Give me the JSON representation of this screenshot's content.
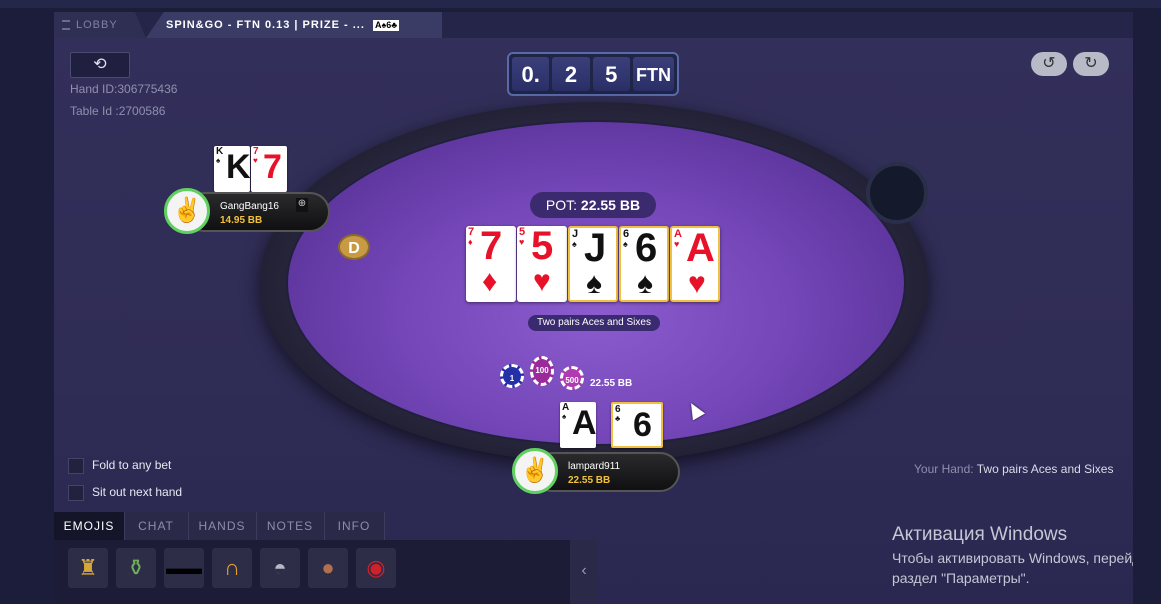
{
  "tabs": {
    "lobby": "LOBBY",
    "table": "SPIN&GO - FTN 0.13 | PRIZE - ...",
    "table_cards": "A♠6♣"
  },
  "toolbar": {
    "hand_id": "Hand ID:306775436",
    "table_id": "Table Id :2700586"
  },
  "stakes": {
    "digits": [
      "0.",
      "2",
      "5"
    ],
    "unit": "FTN"
  },
  "pot": {
    "label": "POT:",
    "value": "22.55 BB"
  },
  "board": {
    "cards": [
      {
        "rank": "7",
        "suit": "♦",
        "color": "red",
        "highlight": false
      },
      {
        "rank": "5",
        "suit": "♥",
        "color": "red",
        "highlight": false
      },
      {
        "rank": "J",
        "suit": "♠",
        "color": "black",
        "highlight": true
      },
      {
        "rank": "6",
        "suit": "♠",
        "color": "black",
        "highlight": true
      },
      {
        "rank": "A",
        "suit": "♥",
        "color": "red",
        "highlight": true
      }
    ],
    "hand_name": "Two pairs Aces and Sixes"
  },
  "dealer_button": "D",
  "players": {
    "opponent": {
      "name": "GangBang16",
      "stack": "14.95 BB",
      "cards": [
        {
          "rank": "K",
          "suit": "♠",
          "color": "black"
        },
        {
          "rank": "7",
          "suit": "♥",
          "color": "red"
        }
      ]
    },
    "hero": {
      "name": "lampard911",
      "stack": "22.55 BB",
      "cards": [
        {
          "rank": "A",
          "suit": "♠",
          "color": "black"
        },
        {
          "rank": "6",
          "suit": "♣",
          "color": "black"
        }
      ]
    }
  },
  "chips": {
    "denominations": [
      "1",
      "100",
      "500"
    ],
    "bet": "22.55 BB"
  },
  "options": {
    "fold_to_any_bet": "Fold to any bet",
    "sit_out_next_hand": "Sit out next hand"
  },
  "your_hand": {
    "label": "Your Hand:",
    "value": "Two pairs Aces and Sixes"
  },
  "panel": {
    "tabs": [
      "EMOJIS",
      "CHAT",
      "HANDS",
      "NOTES",
      "INFO"
    ],
    "active_tab": "EMOJIS",
    "emojis": [
      "trophy-icon",
      "bottle-icon",
      "sunglasses-icon",
      "horseshoe-icon",
      "fish-icon",
      "egg-icon",
      "lips-icon"
    ]
  },
  "windows_activation": {
    "title": "Активация Windows",
    "line1": "Чтобы активировать Windows, перейди",
    "line2": "раздел \"Параметры\"."
  },
  "colors": {
    "felt": "#7446b8",
    "accent_gold": "#f3c23a",
    "avatar_ring": "#60d060"
  }
}
